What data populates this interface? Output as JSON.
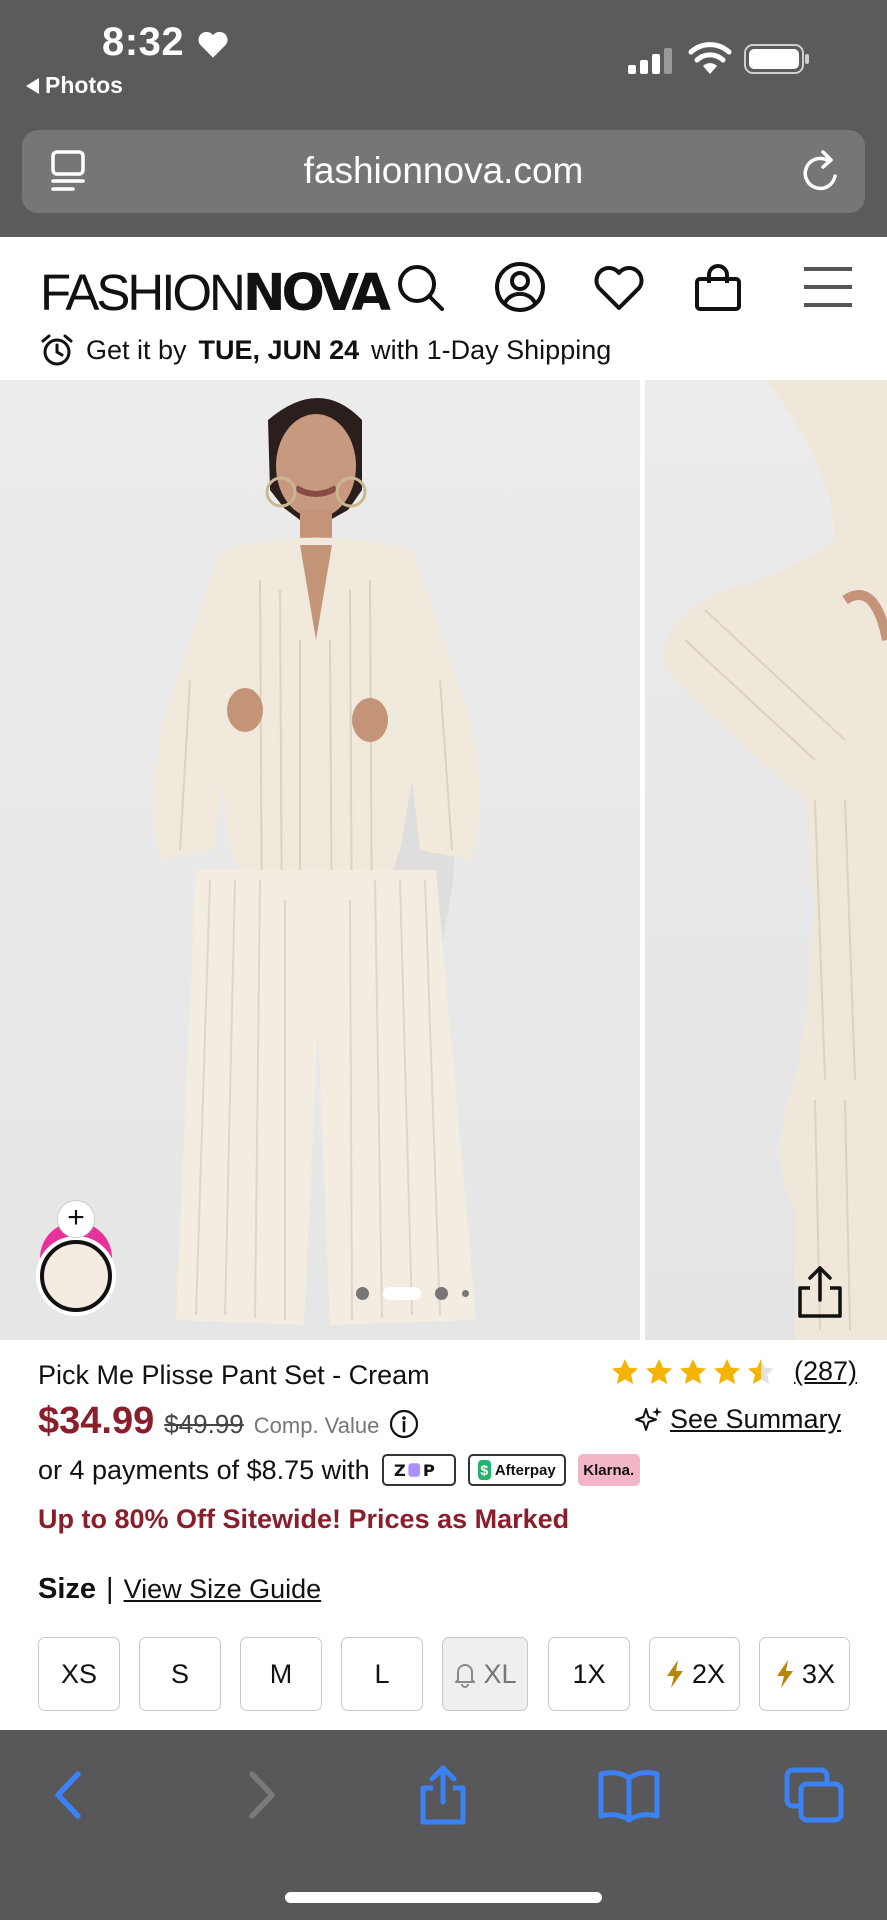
{
  "status_bar": {
    "time": "8:32",
    "back_label": "Photos"
  },
  "safari": {
    "url": "fashionnova.com"
  },
  "header": {
    "logo_thin": "FASHION",
    "logo_bold": "NOVA",
    "shipping_prefix": "Get it by",
    "shipping_date": "TUE, JUN 24",
    "shipping_suffix": "with 1-Day Shipping"
  },
  "gallery": {
    "image_count": 4,
    "active_index": 1
  },
  "product": {
    "title": "Pick Me Plisse Pant Set - Cream",
    "rating": 4.5,
    "review_count": "(287)",
    "price": "$34.99",
    "compare_price": "$49.99",
    "compare_label": "Comp. Value",
    "summary_label": "See Summary",
    "installments_text": "or 4 payments of $8.75 with",
    "pay_badges": {
      "zip": "ZIP",
      "afterpay": "Afterpay",
      "klarna": "Klarna."
    },
    "promo": "Up to 80% Off Sitewide! Prices as Marked",
    "size_label": "Size",
    "size_separator": "|",
    "size_guide": "View Size Guide",
    "sizes": [
      {
        "label": "XS",
        "state": "available"
      },
      {
        "label": "S",
        "state": "available"
      },
      {
        "label": "M",
        "state": "available"
      },
      {
        "label": "L",
        "state": "available"
      },
      {
        "label": "XL",
        "state": "notify"
      },
      {
        "label": "1X",
        "state": "available"
      },
      {
        "label": "2X",
        "state": "low-stock"
      },
      {
        "label": "3X",
        "state": "low-stock"
      }
    ]
  },
  "colors": {
    "price_red": "#8b1e2b",
    "star_gold": "#f5b301",
    "swatch_cream": "#f4ebe1",
    "swatch_pink": "#e7319b",
    "safari_blue": "#2f80ed"
  }
}
